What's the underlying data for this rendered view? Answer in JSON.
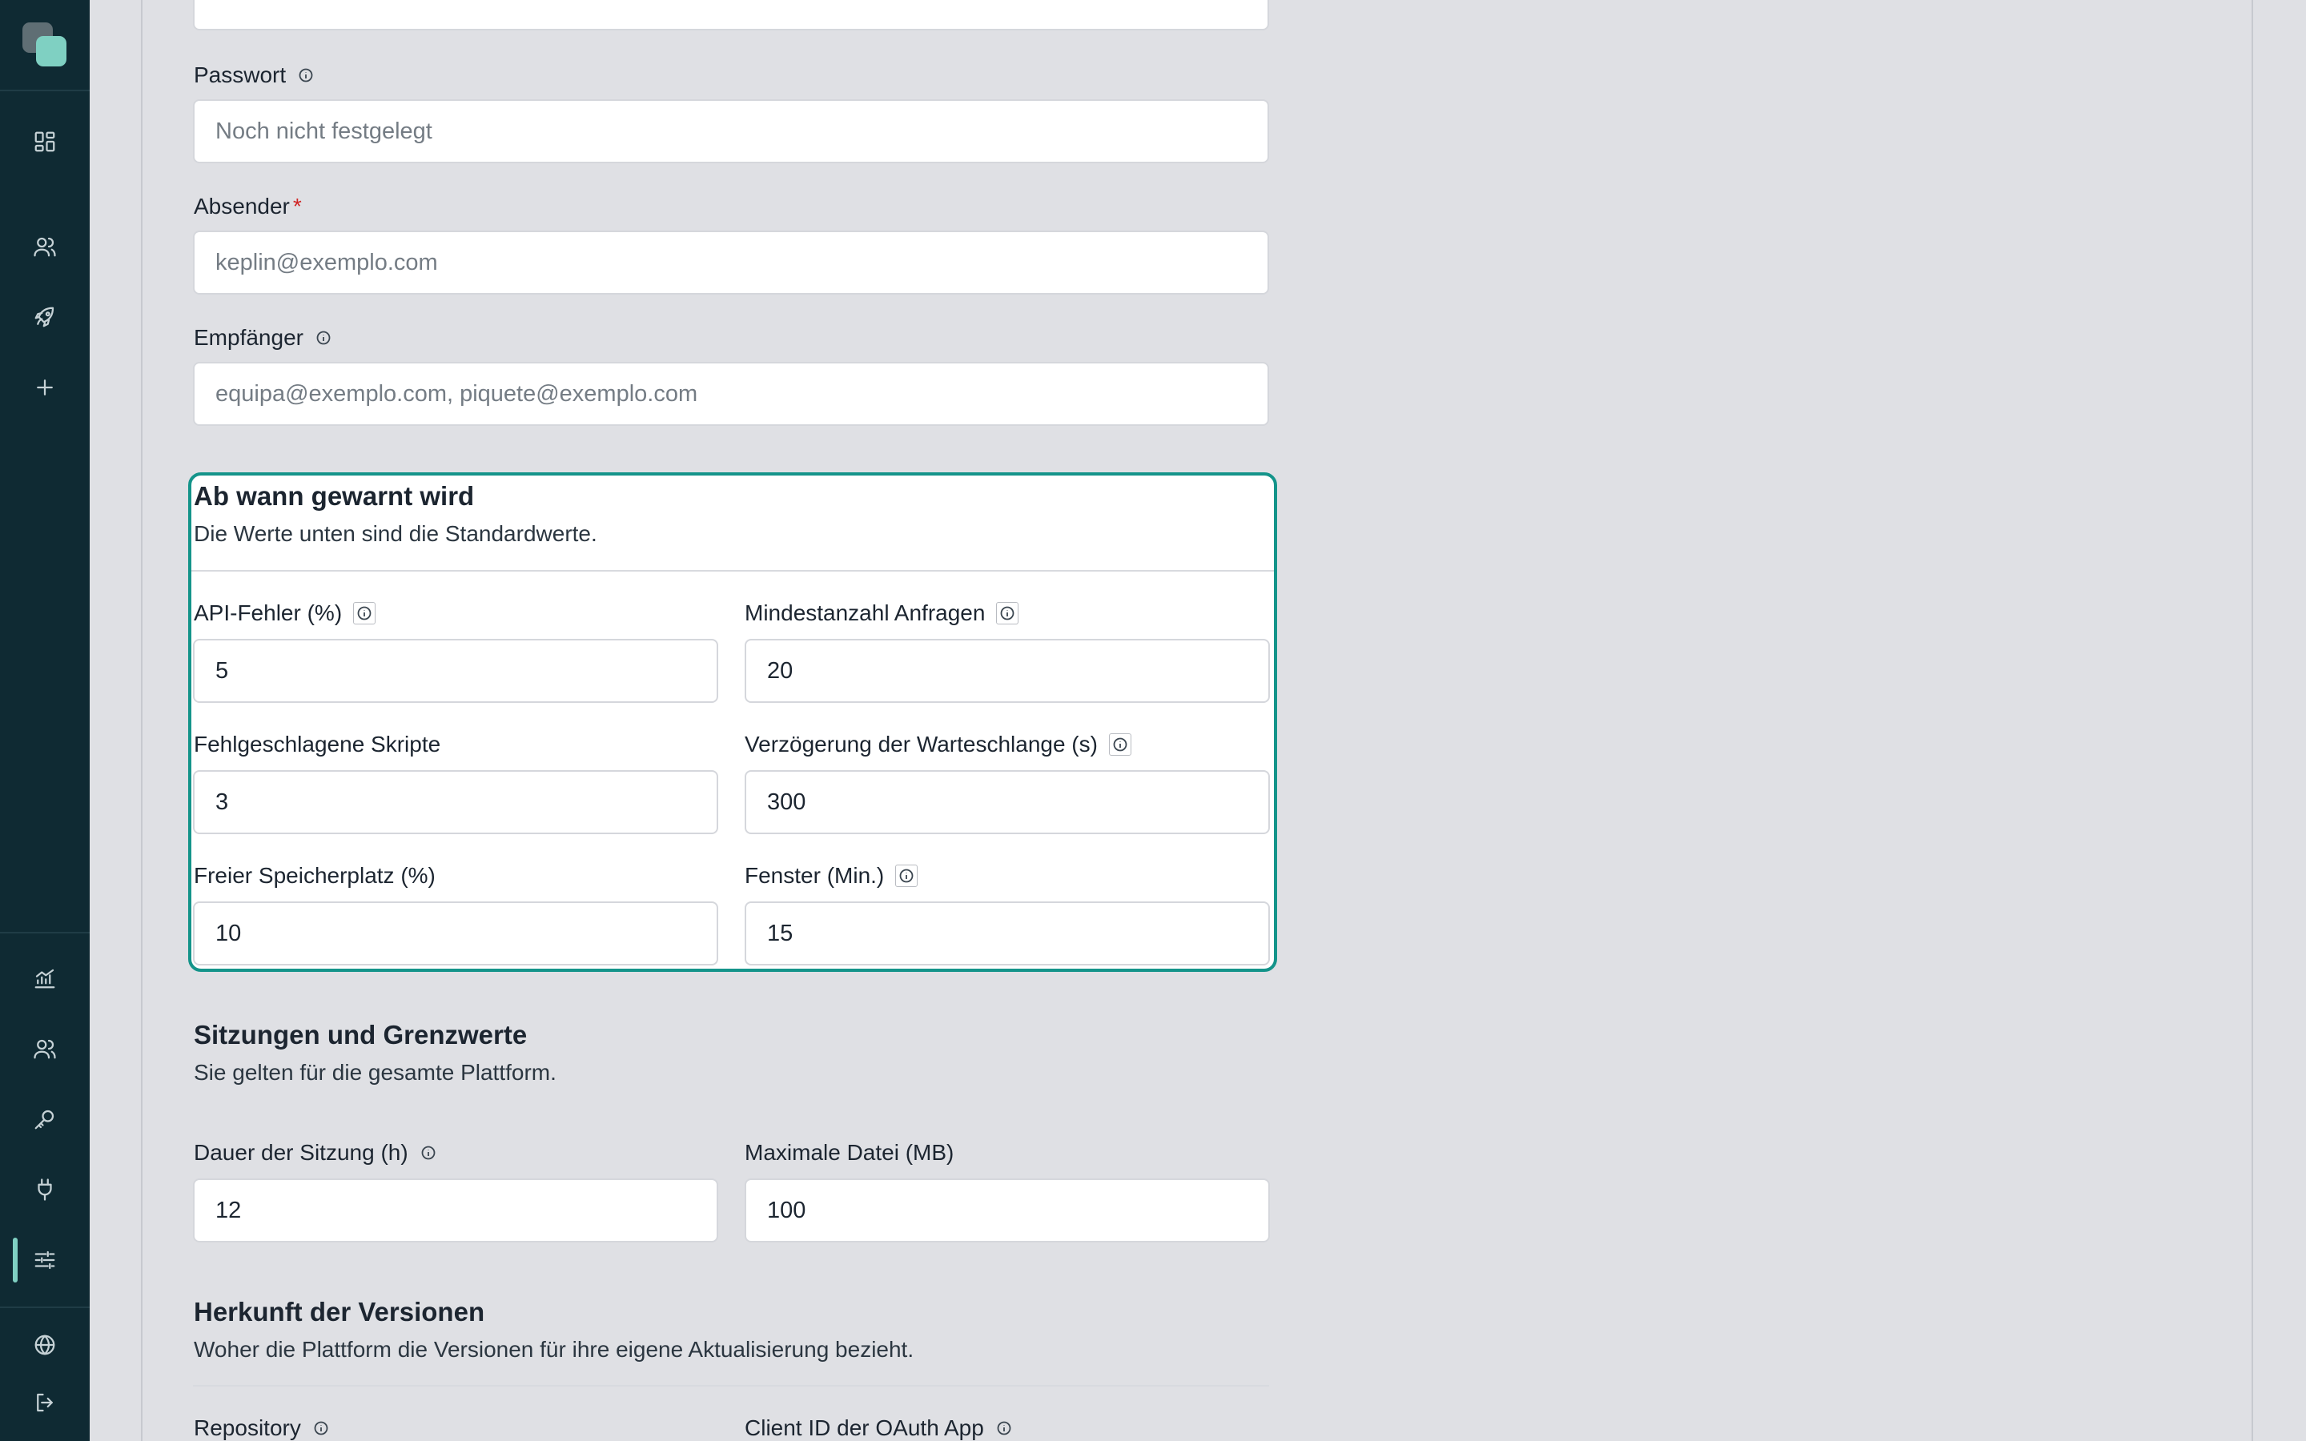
{
  "sidebar": {
    "icons": [
      "dashboard-icon",
      "users-icon",
      "rocket-icon",
      "plus-icon",
      "chart-icon",
      "team-icon",
      "key-icon",
      "plug-icon",
      "sliders-icon",
      "globe-icon",
      "logout-icon"
    ],
    "active": "sliders-icon"
  },
  "form": {
    "top_input_value": "",
    "password": {
      "label": "Passwort",
      "placeholder": "Noch nicht festgelegt"
    },
    "sender": {
      "label": "Absender",
      "required_mark": "*",
      "placeholder": "keplin@exemplo.com"
    },
    "recipients": {
      "label": "Empfänger",
      "placeholder": "equipa@exemplo.com, piquete@exemplo.com"
    }
  },
  "alerts": {
    "title": "Ab wann gewarnt wird",
    "subtitle": "Die Werte unten sind die Standardwerte.",
    "api_errors": {
      "label": "API-Fehler (%)",
      "value": "5"
    },
    "min_requests": {
      "label": "Mindestanzahl Anfragen",
      "value": "20"
    },
    "failed_scripts": {
      "label": "Fehlgeschlagene Skripte",
      "value": "3"
    },
    "queue_delay": {
      "label": "Verzögerung der Warteschlange (s)",
      "value": "300"
    },
    "free_storage": {
      "label": "Freier Speicherplatz (%)",
      "value": "10"
    },
    "window": {
      "label": "Fenster (Min.)",
      "value": "15"
    }
  },
  "sessions": {
    "title": "Sitzungen und Grenzwerte",
    "subtitle": "Sie gelten für die gesamte Plattform.",
    "duration": {
      "label": "Dauer der Sitzung (h)",
      "value": "12"
    },
    "max_file": {
      "label": "Maximale Datei (MB)",
      "value": "100"
    }
  },
  "versions": {
    "title": "Herkunft der Versionen",
    "subtitle": "Woher die Plattform die Versionen für ihre eigene Aktualisierung bezieht.",
    "repository": {
      "label": "Repository"
    },
    "client_id": {
      "label": "Client ID der OAuth App"
    }
  },
  "colors": {
    "sidebar_bg": "#0f2a33",
    "accent": "#14948a",
    "logo_accent": "#7fd0c2",
    "required": "#d02525"
  }
}
